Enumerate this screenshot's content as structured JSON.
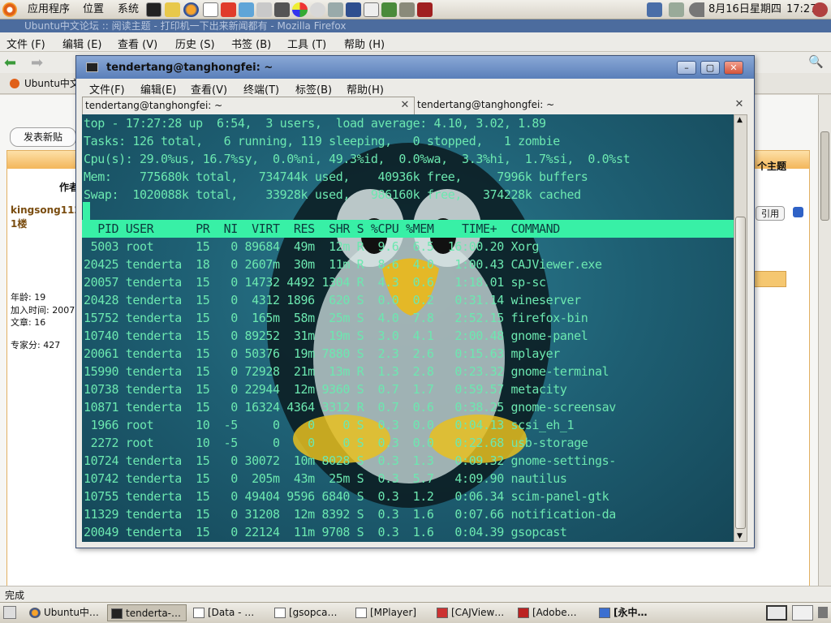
{
  "top_panel": {
    "menus": [
      "应用程序",
      "位置",
      "系统"
    ],
    "datetime": "8月16日星期四",
    "time": "17:27"
  },
  "firefox": {
    "title": "Ubuntu中文论坛 :: 阅读主题 - 打印机一下出来新闻都有  -  Mozilla Firefox",
    "menus": [
      "文件 (F)",
      "编辑 (E)",
      "查看 (V)",
      "历史 (S)",
      "书签 (B)",
      "工具 (T)",
      "帮助 (H)"
    ],
    "bookmark": "Ubuntu中文",
    "post_button": "发表新贴",
    "forum": {
      "author_header": "作者",
      "username": "kingsong112",
      "floor": "1楼",
      "age": "年龄: 19",
      "joined": "加入时间: 2007",
      "posts": "文章: 16",
      "points": "专家分: 427",
      "next_topic": "个主题",
      "quote": "引用"
    },
    "status": "完成"
  },
  "terminal": {
    "title": "tendertang@tanghongfei: ~",
    "menus": [
      "文件(F)",
      "编辑(E)",
      "查看(V)",
      "终端(T)",
      "标签(B)",
      "帮助(H)"
    ],
    "tabs": [
      "tendertang@tanghongfei: ~",
      "tendertang@tanghongfei: ~"
    ],
    "summary": [
      "top - 17:27:28 up  6:54,  3 users,  load average: 4.10, 3.02, 1.89",
      "Tasks: 126 total,   6 running, 119 sleeping,   0 stopped,   1 zombie",
      "Cpu(s): 29.0%us, 16.7%sy,  0.0%ni, 49.3%id,  0.0%wa,  3.3%hi,  1.7%si,  0.0%st",
      "Mem:    775680k total,   734744k used,    40936k free,     7996k buffers",
      "Swap:  1020088k total,    33928k used,   986160k free,   374228k cached"
    ],
    "header": "  PID USER      PR  NI  VIRT  RES  SHR S %CPU %MEM    TIME+  COMMAND",
    "processes": [
      " 5003 root      15   0 89684  49m  12m R  9.6  6.5  16:00.20 Xorg",
      "20425 tenderta  18   0 2607m  30m  11m R  8.6  4.0   1:00.43 CAJViewer.exe",
      "20057 tenderta  15   0 14732 4492 1304 R  4.3  0.6   1:18.01 sp-sc",
      "20428 tenderta  15   0  4312 1896  620 S  0.0  0.2   0:31.14 wineserver",
      "15752 tenderta  15   0  165m  58m  25m S  4.0  7.8   2:52.15 firefox-bin",
      "10740 tenderta  15   0 89252  31m  19m S  3.0  4.1   2:00.48 gnome-panel",
      "20061 tenderta  15   0 50376  19m 7880 S  2.3  2.6   0:15.63 mplayer",
      "15990 tenderta  15   0 72928  21m  13m R  1.3  2.8   0:23.32 gnome-terminal",
      "10738 tenderta  15   0 22944  12m 9360 S  0.7  1.7   0:59.57 metacity",
      "10871 tenderta  15   0 16324 4364 3312 R  0.7  0.6   0:38.25 gnome-screensav",
      " 1966 root      10  -5     0    0    0 S  0.3  0.0   0:04.13 scsi_eh_1",
      " 2272 root      10  -5     0    0    0 S  0.3  0.0   0:22.68 usb-storage",
      "10724 tenderta  15   0 30072  10m 8028 S  0.3  1.3   0:09.32 gnome-settings-",
      "10742 tenderta  15   0  205m  43m  25m S  0.3  5.7   4:09.90 nautilus",
      "10755 tenderta  15   0 49404 9596 6840 S  0.3  1.2   0:06.34 scim-panel-gtk",
      "11329 tenderta  15   0 31208  12m 8392 S  0.3  1.6   0:07.66 notification-da",
      "20049 tenderta  15   0 22124  11m 9708 S  0.3  1.6   0:04.39 gsopcast"
    ]
  },
  "taskbar": {
    "items": [
      "Ubuntu中…",
      "tenderta-…",
      "[Data - …",
      "[gsopca…",
      "[MPlayer]",
      "[CAJView…",
      "[Adobe…",
      "[永中…"
    ]
  },
  "colors": {
    "terminal_text": "#6ce8b0",
    "terminal_highlight": "#38f0a6",
    "title_bar": "#5a7fba"
  }
}
